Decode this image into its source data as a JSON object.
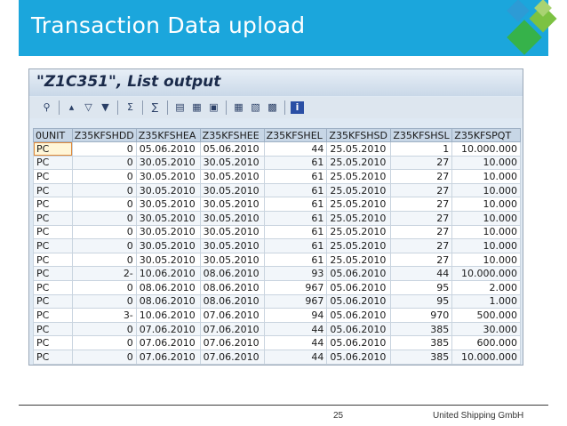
{
  "slide": {
    "title": "Transaction Data upload",
    "page_number": "25",
    "company": "United Shipping GmbH",
    "accent_colors": {
      "title_bar": "#1ba6dc",
      "deco_green": "#36b24a",
      "deco_light_green": "#7cc242"
    }
  },
  "sap": {
    "title": "\"Z1C351\", List output",
    "toolbar_icons": [
      "details-icon",
      "print-icon",
      "filter-icon",
      "filter-settings-icon",
      "sum-icon",
      "subtotal-icon",
      "export-icon",
      "spreadsheet-icon",
      "word-processing-icon",
      "change-layout-icon",
      "grid-icon",
      "select-layout-icon",
      "save-layout-icon",
      "information-icon"
    ],
    "columns": [
      "0UNIT",
      "Z35KFSHDD",
      "Z35KFSHEA",
      "Z35KFSHEE",
      "Z35KFSHEL",
      "Z35KFSHSD",
      "Z35KFSHSL",
      "Z35KFSPQT"
    ],
    "rows": [
      [
        "PC",
        "0",
        "05.06.2010",
        "05.06.2010",
        "44",
        "25.05.2010",
        "1",
        "10.000.000"
      ],
      [
        "PC",
        "0",
        "30.05.2010",
        "30.05.2010",
        "61",
        "25.05.2010",
        "27",
        "10.000"
      ],
      [
        "PC",
        "0",
        "30.05.2010",
        "30.05.2010",
        "61",
        "25.05.2010",
        "27",
        "10.000"
      ],
      [
        "PC",
        "0",
        "30.05.2010",
        "30.05.2010",
        "61",
        "25.05.2010",
        "27",
        "10.000"
      ],
      [
        "PC",
        "0",
        "30.05.2010",
        "30.05.2010",
        "61",
        "25.05.2010",
        "27",
        "10.000"
      ],
      [
        "PC",
        "0",
        "30.05.2010",
        "30.05.2010",
        "61",
        "25.05.2010",
        "27",
        "10.000"
      ],
      [
        "PC",
        "0",
        "30.05.2010",
        "30.05.2010",
        "61",
        "25.05.2010",
        "27",
        "10.000"
      ],
      [
        "PC",
        "0",
        "30.05.2010",
        "30.05.2010",
        "61",
        "25.05.2010",
        "27",
        "10.000"
      ],
      [
        "PC",
        "0",
        "30.05.2010",
        "30.05.2010",
        "61",
        "25.05.2010",
        "27",
        "10.000"
      ],
      [
        "PC",
        "2-",
        "10.06.2010",
        "08.06.2010",
        "93",
        "05.06.2010",
        "44",
        "10.000.000"
      ],
      [
        "PC",
        "0",
        "08.06.2010",
        "08.06.2010",
        "967",
        "05.06.2010",
        "95",
        "2.000"
      ],
      [
        "PC",
        "0",
        "08.06.2010",
        "08.06.2010",
        "967",
        "05.06.2010",
        "95",
        "1.000"
      ],
      [
        "PC",
        "3-",
        "10.06.2010",
        "07.06.2010",
        "94",
        "05.06.2010",
        "970",
        "500.000"
      ],
      [
        "PC",
        "0",
        "07.06.2010",
        "07.06.2010",
        "44",
        "05.06.2010",
        "385",
        "30.000"
      ],
      [
        "PC",
        "0",
        "07.06.2010",
        "07.06.2010",
        "44",
        "05.06.2010",
        "385",
        "600.000"
      ],
      [
        "PC",
        "0",
        "07.06.2010",
        "07.06.2010",
        "44",
        "05.06.2010",
        "385",
        "10.000.000"
      ]
    ]
  }
}
